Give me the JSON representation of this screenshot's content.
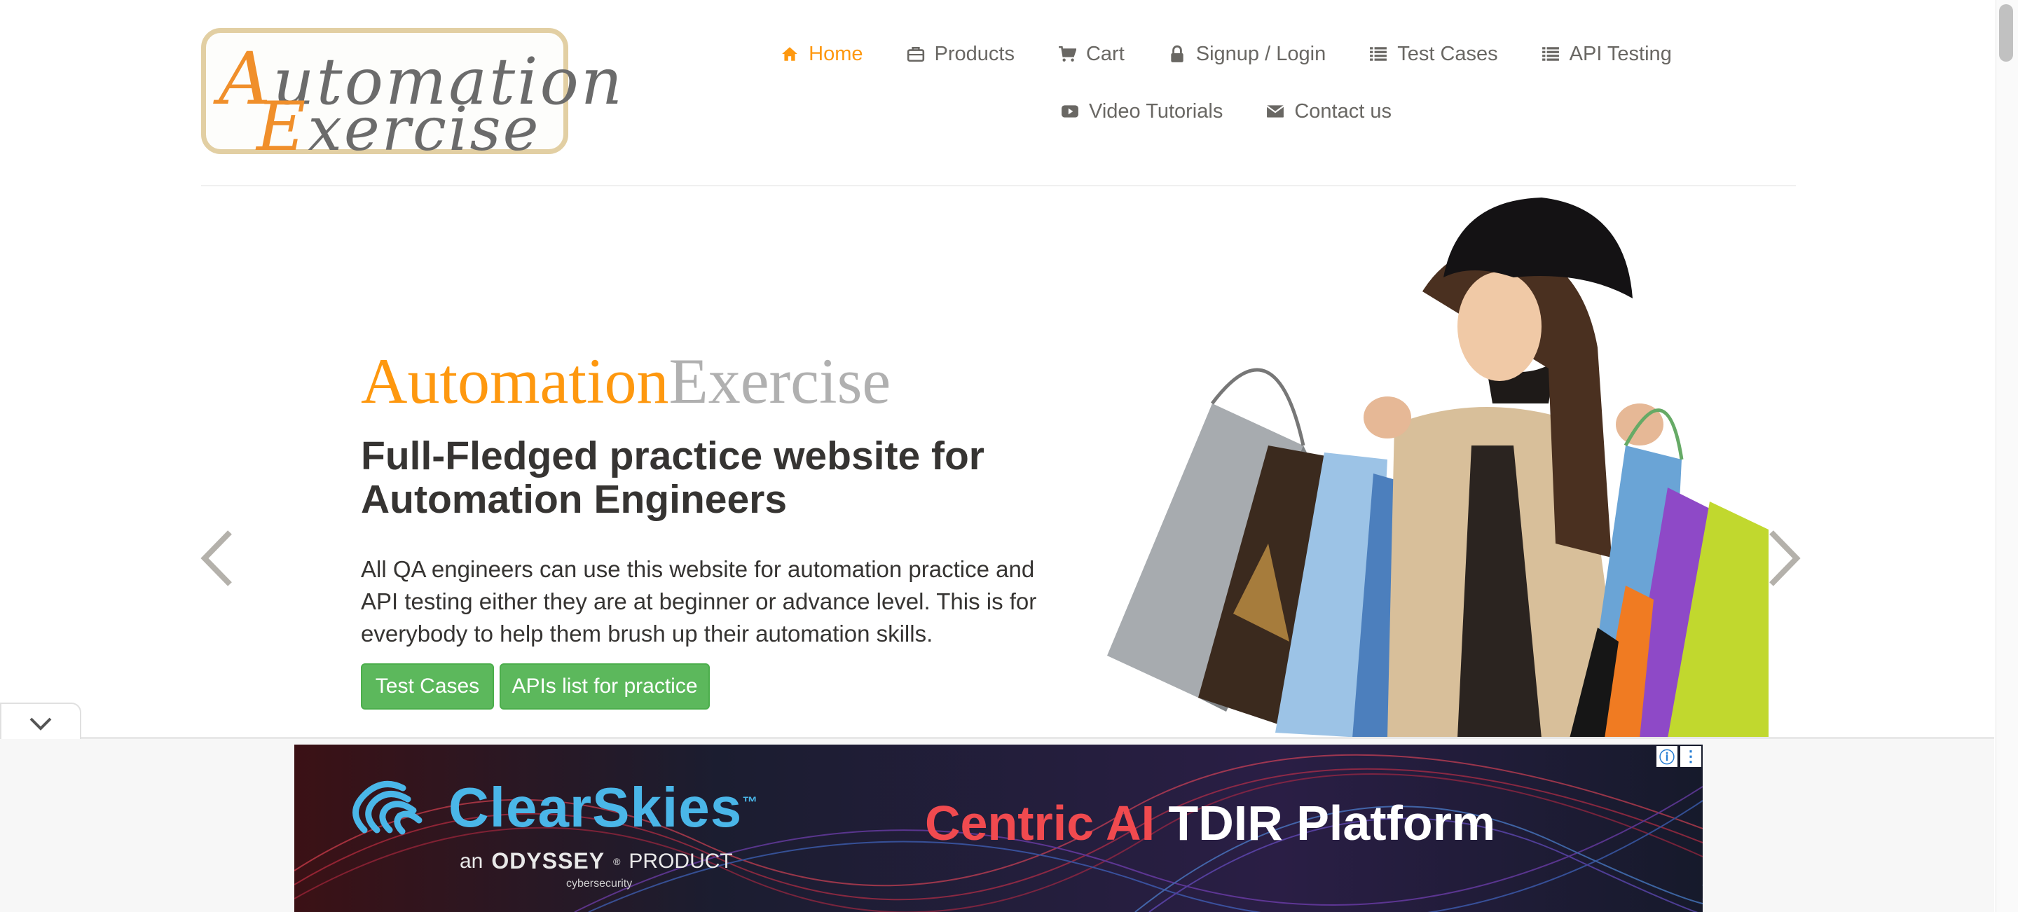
{
  "logo": {
    "line1": "Automation",
    "line2": "Exercise"
  },
  "nav": {
    "items": [
      {
        "label": "Home",
        "icon": "home-icon",
        "active": true
      },
      {
        "label": "Products",
        "icon": "briefcase-icon"
      },
      {
        "label": "Cart",
        "icon": "cart-icon"
      },
      {
        "label": "Signup / Login",
        "icon": "lock-icon"
      },
      {
        "label": "Test Cases",
        "icon": "list-icon"
      },
      {
        "label": "API Testing",
        "icon": "list-icon"
      },
      {
        "label": "Video Tutorials",
        "icon": "youtube-icon"
      },
      {
        "label": "Contact us",
        "icon": "envelope-icon"
      }
    ]
  },
  "hero": {
    "brand_part1": "Automation",
    "brand_part2": "Exercise",
    "heading": "Full-Fledged practice website for Automation Engineers",
    "description": "All QA engineers can use this website for automation practice and API testing either they are at beginner or advance level. This is for everybody to help them brush up their automation skills.",
    "button_test_cases": "Test Cases",
    "button_apis": "APIs list for practice"
  },
  "ad": {
    "brand": "ClearSkies",
    "trademark": "™",
    "sub_prefix": "an",
    "sub_company": "ODYSSEY",
    "sub_registered": "®",
    "sub_suffix": "PRODUCT",
    "sub_small": "cybersecurity",
    "tagline_part1": "Centric AI",
    "tagline_part2": "TDIR Platform",
    "info_icon": "info-icon",
    "menu_icon": "kebab-menu-icon"
  },
  "colors": {
    "accent": "#fe980f",
    "button_green": "#5cb85c",
    "text_dark": "#363432",
    "text_muted": "#696763",
    "ad_blue": "#4ab6e8",
    "ad_red": "#f04a4f"
  }
}
